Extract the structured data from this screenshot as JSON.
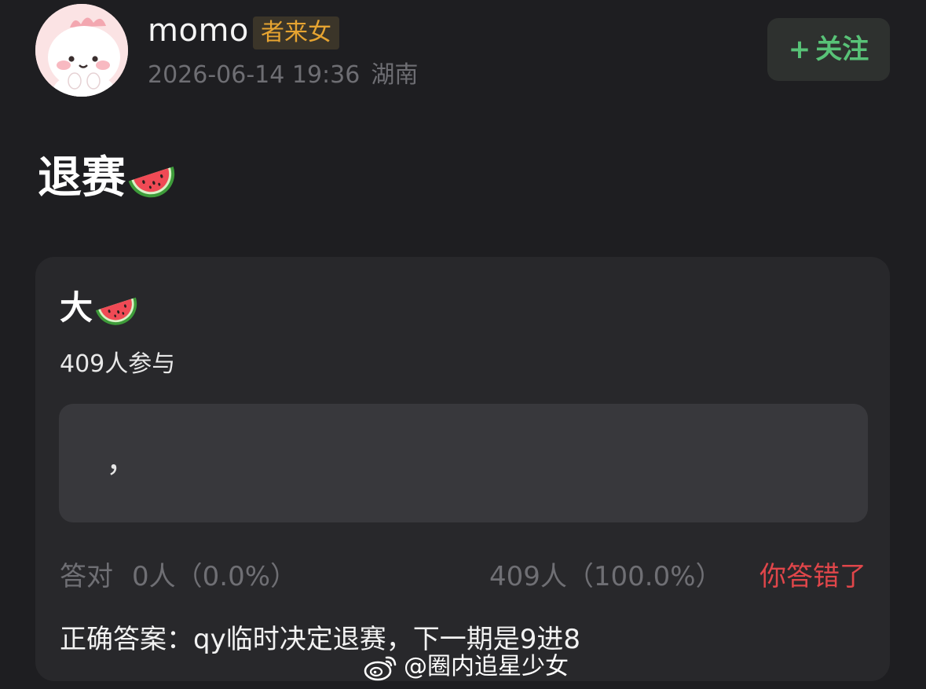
{
  "header": {
    "avatar_icon": "cartoon-dinosaur-avatar-icon",
    "username": "momo",
    "badge": "者来女",
    "timestamp": "2026-06-14 19:36",
    "location": "湖南",
    "follow_label": "+关注",
    "follow_plus": "+",
    "follow_text": "关注",
    "follow_color": "#58c277"
  },
  "post": {
    "text": "退赛",
    "emoji": "watermelon-icon"
  },
  "quiz": {
    "question": "大",
    "question_emoji": "watermelon-icon",
    "participants": "409人参与",
    "options": [
      {
        "text": "，"
      }
    ],
    "correct_label": "答对",
    "correct_count": "0人（0.0%）",
    "wrong_count": "409人（100.0%）",
    "wrong_label": "你答错了",
    "wrong_color": "#e0464a",
    "answer": "正确答案：qy临时决定退赛，下一期是9进8"
  },
  "watermark": {
    "icon": "weibo-logo-icon",
    "text": "@圈内追星少女"
  }
}
